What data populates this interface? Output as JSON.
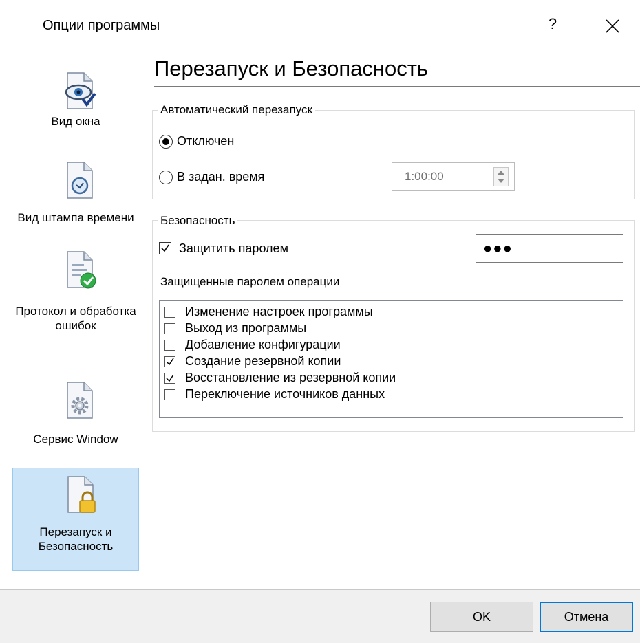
{
  "window": {
    "title": "Опции программы",
    "help_label": "?",
    "close_icon": "close-icon"
  },
  "sidebar": {
    "items": [
      {
        "label": "Вид окна",
        "icon": "eye-document-icon",
        "active": false
      },
      {
        "label": "Вид штампа времени",
        "icon": "clock-document-icon",
        "active": false
      },
      {
        "label": "Протокол и обработка ошибок",
        "icon": "check-document-icon",
        "active": false
      },
      {
        "label": "Сервис Window",
        "icon": "gear-document-icon",
        "active": false
      },
      {
        "label": "Перезапуск и Безопасность",
        "icon": "lock-document-icon",
        "active": true
      }
    ]
  },
  "main": {
    "heading": "Перезапуск и Безопасность",
    "restart": {
      "group_title": "Автоматический перезапуск",
      "option_off": "Отключен",
      "option_time": "В задан. время",
      "selected": "off",
      "time_value": "1:00:00"
    },
    "security": {
      "group_title": "Безопасность",
      "protect_label": "Защитить паролем",
      "protect_checked": true,
      "password_value": "●●●",
      "ops_label": "Защищенные паролем операции",
      "operations": [
        {
          "label": "Изменение настроек программы",
          "checked": false
        },
        {
          "label": "Выход из программы",
          "checked": false
        },
        {
          "label": "Добавление конфигурации",
          "checked": false
        },
        {
          "label": "Создание резервной копии",
          "checked": true
        },
        {
          "label": "Восстановление из резервной копии",
          "checked": true
        },
        {
          "label": "Переключение источников данных",
          "checked": false
        }
      ]
    }
  },
  "footer": {
    "ok_label": "OK",
    "cancel_label": "Отмена"
  },
  "colors": {
    "accent": "#0078d7",
    "active_item_bg": "#cce4f7",
    "footer_bg": "#f0f0f0"
  }
}
